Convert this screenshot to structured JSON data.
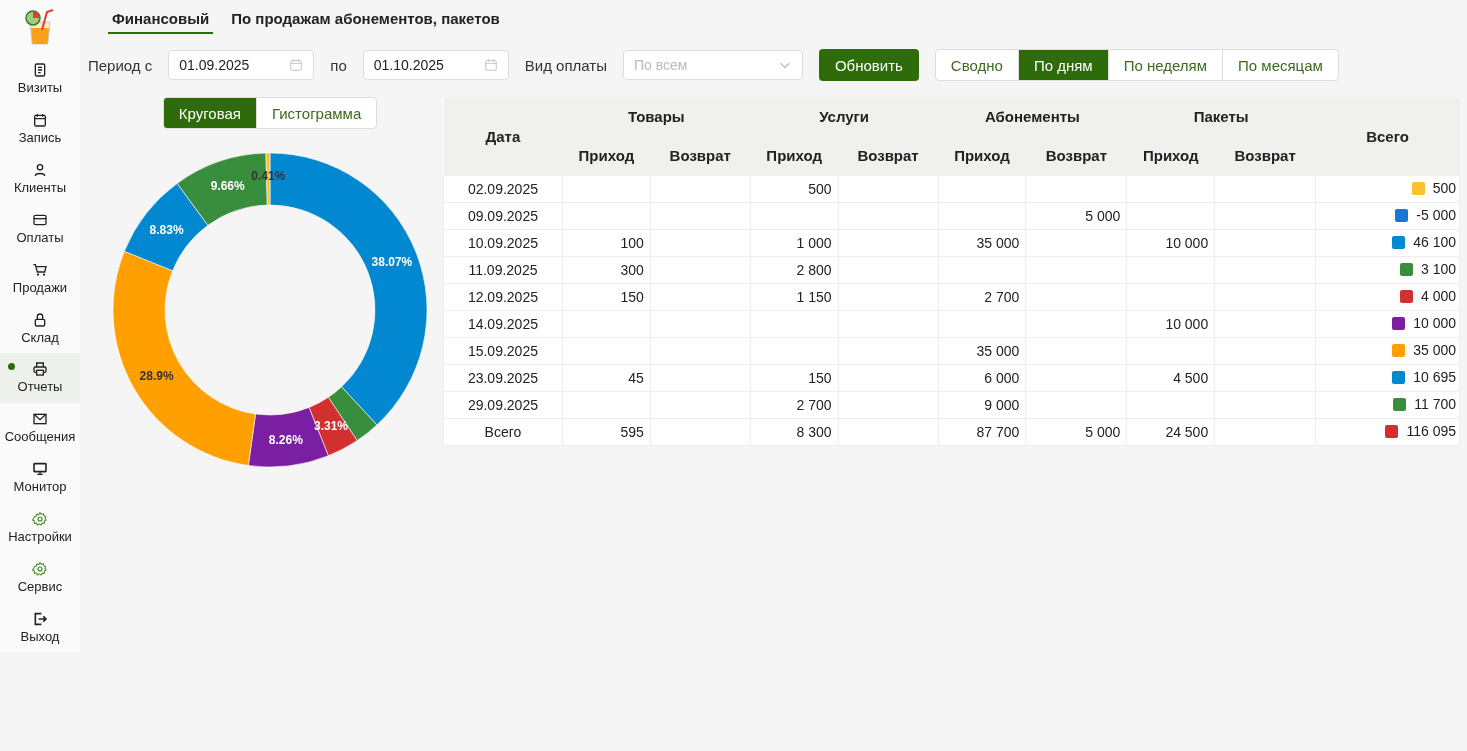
{
  "sidebar": {
    "items": [
      {
        "label": "Визиты",
        "selected": false
      },
      {
        "label": "Запись",
        "selected": false
      },
      {
        "label": "Клиенты",
        "selected": false
      },
      {
        "label": "Оплаты",
        "selected": false
      },
      {
        "label": "Продажи",
        "selected": false
      },
      {
        "label": "Склад",
        "selected": false
      },
      {
        "label": "Отчеты",
        "selected": true
      },
      {
        "label": "Сообщения",
        "selected": false
      },
      {
        "label": "Монитор",
        "selected": false
      },
      {
        "label": "Настройки",
        "selected": false
      },
      {
        "label": "Сервис",
        "selected": false
      },
      {
        "label": "Выход",
        "selected": false
      }
    ]
  },
  "tabs": [
    {
      "label": "Финансовый",
      "selected": true
    },
    {
      "label": "По продажам абонементов, пакетов",
      "selected": false
    }
  ],
  "filters": {
    "period_label": "Период с",
    "date_from": "01.09.2025",
    "to_label": "по",
    "date_to": "01.10.2025",
    "payment_label": "Вид оплаты",
    "payment": {
      "placeholder": "По всем"
    },
    "refresh_button": "Обновить",
    "views": [
      {
        "label": "Сводно",
        "selected": false
      },
      {
        "label": "По дням",
        "selected": true
      },
      {
        "label": "По неделям",
        "selected": false
      },
      {
        "label": "По месяцам",
        "selected": false
      }
    ]
  },
  "chart_toggle": [
    {
      "label": "Круговая",
      "selected": true
    },
    {
      "label": "Гистограмма",
      "selected": false
    }
  ],
  "chart": {
    "chart_data": {
      "type": "donut",
      "values": [
        38.07,
        2.56,
        3.31,
        8.26,
        28.9,
        8.83,
        9.66,
        0.41
      ],
      "colors": [
        "#0288d1",
        "#388e3c",
        "#d32f2f",
        "#7b1fa2",
        "#ffa000",
        "#0288d1",
        "#388e3c",
        "#fbc02d"
      ],
      "value_labels": [
        "38.07%",
        null,
        "3.31%",
        "8.26%",
        "28.9%",
        "8.83%",
        "9.66%",
        "0.41%"
      ]
    }
  },
  "table": {
    "date_column": "Дата",
    "groups": [
      {
        "title": "Товары",
        "columns": [
          "Приход",
          "Возврат"
        ]
      },
      {
        "title": "Услуги",
        "columns": [
          "Приход",
          "Возврат"
        ]
      },
      {
        "title": "Абонементы",
        "columns": [
          "Приход",
          "Возврат"
        ]
      },
      {
        "title": "Пакеты",
        "columns": [
          "Приход",
          "Возврат"
        ]
      }
    ],
    "total_column": "Всего",
    "rows": [
      {
        "date": "02.09.2025",
        "cells": [
          null,
          null,
          "500",
          null,
          null,
          null,
          null,
          null
        ],
        "total": "500",
        "color": "#fbc02d"
      },
      {
        "date": "09.09.2025",
        "cells": [
          null,
          null,
          null,
          null,
          null,
          "5 000",
          null,
          null
        ],
        "total": "-5 000",
        "color": "#1976d2"
      },
      {
        "date": "10.09.2025",
        "cells": [
          "100",
          null,
          "1 000",
          null,
          "35 000",
          null,
          "10 000",
          null
        ],
        "total": "46 100",
        "color": "#0288d1"
      },
      {
        "date": "11.09.2025",
        "cells": [
          "300",
          null,
          "2 800",
          null,
          null,
          null,
          null,
          null
        ],
        "total": "3 100",
        "color": "#388e3c"
      },
      {
        "date": "12.09.2025",
        "cells": [
          "150",
          null,
          "1 150",
          null,
          "2 700",
          null,
          null,
          null
        ],
        "total": "4 000",
        "color": "#d32f2f"
      },
      {
        "date": "14.09.2025",
        "cells": [
          null,
          null,
          null,
          null,
          null,
          null,
          "10 000",
          null
        ],
        "total": "10 000",
        "color": "#7b1fa2"
      },
      {
        "date": "15.09.2025",
        "cells": [
          null,
          null,
          null,
          null,
          "35 000",
          null,
          null,
          null
        ],
        "total": "35 000",
        "color": "#ffa000"
      },
      {
        "date": "23.09.2025",
        "cells": [
          "45",
          null,
          "150",
          null,
          "6 000",
          null,
          "4 500",
          null
        ],
        "total": "10 695",
        "color": "#0288d1"
      },
      {
        "date": "29.09.2025",
        "cells": [
          null,
          null,
          "2 700",
          null,
          "9 000",
          null,
          null,
          null
        ],
        "total": "11 700",
        "color": "#388e3c"
      },
      {
        "date": "Всего",
        "cells": [
          "595",
          null,
          "8 300",
          null,
          "87 700",
          "5 000",
          "24 500",
          null
        ],
        "total": "116 095",
        "color": "#d32f2f"
      }
    ]
  }
}
